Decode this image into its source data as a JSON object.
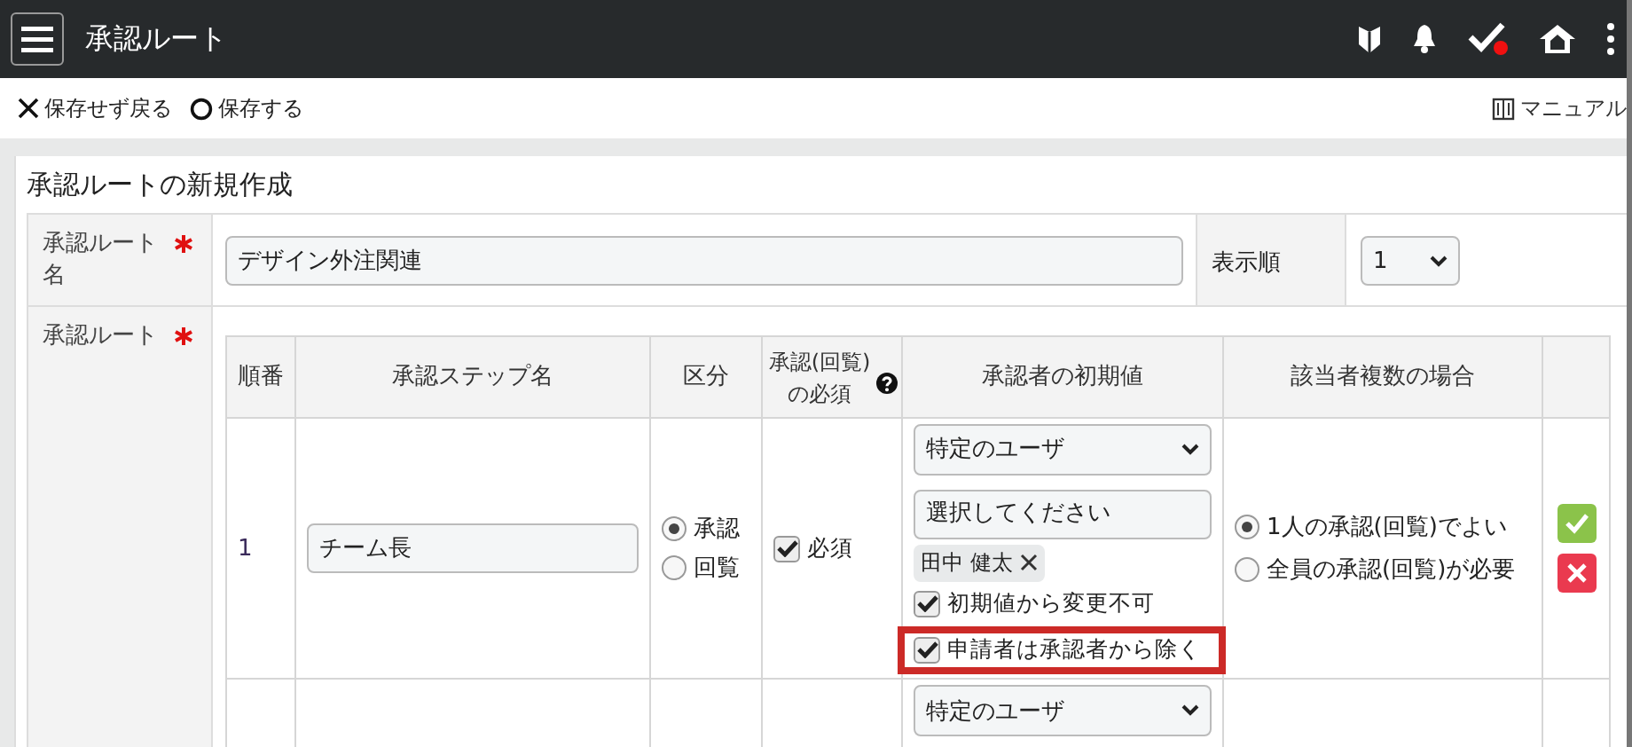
{
  "header": {
    "title": "承認ルート",
    "icons": [
      {
        "kind": "shield"
      },
      {
        "kind": "bell"
      },
      {
        "kind": "check",
        "badge": true
      },
      {
        "kind": "home"
      },
      {
        "kind": "more"
      }
    ]
  },
  "toolbar": {
    "actions": [
      {
        "kind": "cross",
        "label": "保存せず戻る"
      },
      {
        "kind": "circle",
        "label": "保存する"
      }
    ],
    "manual_link": "マニュアル"
  },
  "form": {
    "title": "承認ルートの新規作成",
    "name_field": {
      "label": "承認ルート名",
      "required": true,
      "value": "デザイン外注関連"
    },
    "order_field": {
      "label": "表示順",
      "value": "1"
    },
    "route": {
      "label": "承認ルート",
      "required": true,
      "columns": [
        {
          "label": "順番"
        },
        {
          "label": "承認ステップ名"
        },
        {
          "label": "区分"
        },
        {
          "label": "承認(回覧)の必須",
          "help": true
        },
        {
          "label": "承認者の初期値"
        },
        {
          "label": "該当者複数の場合"
        }
      ],
      "rows": [
        {
          "order": "1",
          "step_name": "チーム長",
          "type_options": [
            {
              "label": "承認",
              "selected": true
            },
            {
              "label": "回覧",
              "selected": false
            }
          ],
          "required": {
            "label": "必須",
            "checked": true
          },
          "approver_select": "特定のユーザ",
          "approver_search": {
            "placeholder": "選択してください"
          },
          "approver_chips": [
            "田中 健太"
          ],
          "approver_options": [
            {
              "label": "初期値から変更不可",
              "checked": true,
              "highlighted": false
            },
            {
              "label": "申請者は承認者から除く",
              "checked": true,
              "highlighted": true
            }
          ],
          "multiple_options": [
            {
              "label": "1人の承認(回覧)でよい",
              "selected": true
            },
            {
              "label": "全員の承認(回覧)が必要",
              "selected": false
            }
          ],
          "actions": [
            {
              "kind": "confirm"
            },
            {
              "kind": "delete"
            }
          ]
        },
        {
          "approver_select": "特定のユーザ"
        }
      ]
    }
  }
}
